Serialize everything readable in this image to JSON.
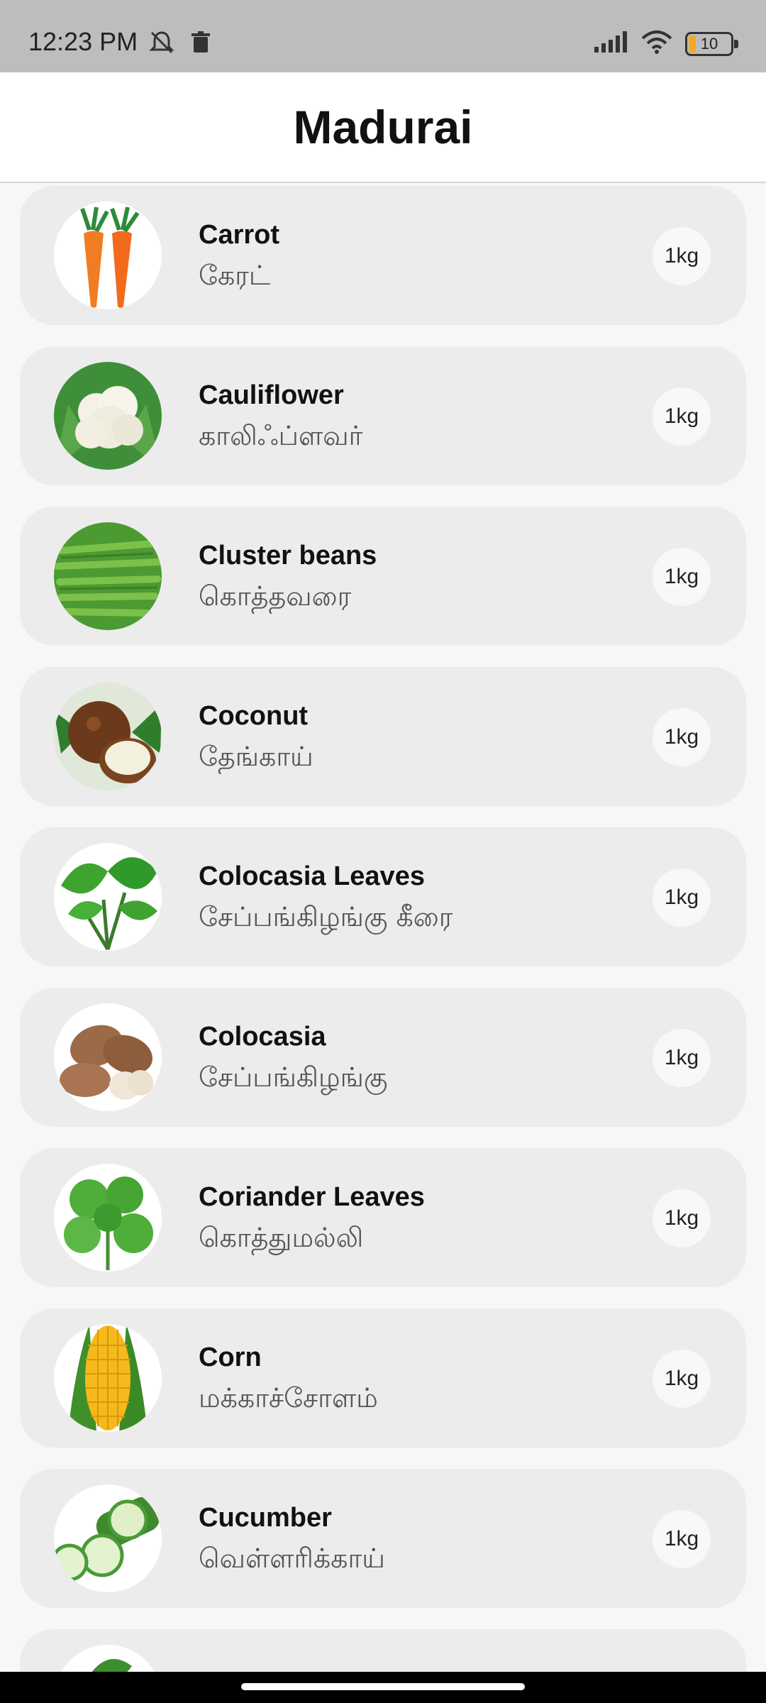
{
  "status_bar": {
    "time": "12:23 PM",
    "battery": "10"
  },
  "header": {
    "title": "Madurai"
  },
  "items": [
    {
      "name_en": "Carrot",
      "name_ta": "கேரட்",
      "qty": "1kg",
      "icon": "carrot-image"
    },
    {
      "name_en": "Cauliflower",
      "name_ta": "காலிஃப்ளவர்",
      "qty": "1kg",
      "icon": "cauliflower-image"
    },
    {
      "name_en": "Cluster beans",
      "name_ta": "கொத்தவரை",
      "qty": "1kg",
      "icon": "cluster-beans-image"
    },
    {
      "name_en": "Coconut",
      "name_ta": "தேங்காய்",
      "qty": "1kg",
      "icon": "coconut-image"
    },
    {
      "name_en": "Colocasia Leaves",
      "name_ta": "சேப்பங்கிழங்கு கீரை",
      "qty": "1kg",
      "icon": "colocasia-leaves-image"
    },
    {
      "name_en": "Colocasia",
      "name_ta": "சேப்பங்கிழங்கு",
      "qty": "1kg",
      "icon": "colocasia-image"
    },
    {
      "name_en": "Coriander Leaves",
      "name_ta": "கொத்துமல்லி",
      "qty": "1kg",
      "icon": "coriander-image"
    },
    {
      "name_en": "Corn",
      "name_ta": "மக்காச்சோளம்",
      "qty": "1kg",
      "icon": "corn-image"
    },
    {
      "name_en": "Cucumber",
      "name_ta": "வெள்ளரிக்காய்",
      "qty": "1kg",
      "icon": "cucumber-image"
    }
  ]
}
